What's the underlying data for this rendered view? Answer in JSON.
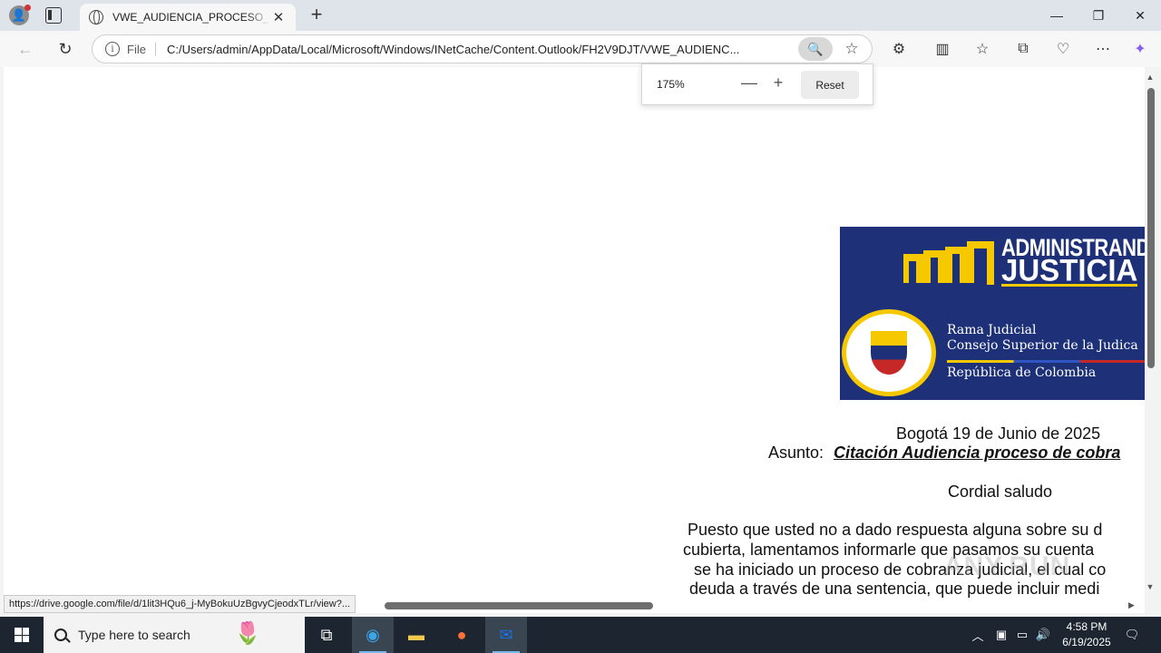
{
  "browser": {
    "tab_title": "VWE_AUDIENCIA_PROCESO_REF",
    "address_prefix": "File",
    "url": "C:/Users/admin/AppData/Local/Microsoft/Windows/INetCache/Content.Outlook/FH2V9DJT/VWE_AUDIENC..."
  },
  "zoom_popup": {
    "level": "175%",
    "minus": "—",
    "plus": "+",
    "reset_label": "Reset"
  },
  "document": {
    "banner": {
      "line1": "ADMINISTRANDO",
      "line2": "JUSTICIA",
      "rama": "Rama Judicial",
      "consejo": "Consejo Superior de la Judica",
      "republica": "República de Colombia"
    },
    "date_line": "Bogotá 19 de Junio de 2025",
    "subject_label": "Asunto:",
    "subject_value": "Citación Audiencia proceso de cobra",
    "greeting": "Cordial saludo",
    "paragraph": [
      "Puesto que usted no a dado respuesta alguna sobre su d",
      "cubierta, lamentamos informarle que pasamos su cuenta",
      "se ha iniciado un proceso de cobranza judicial, el cual co",
      "deuda a través de una sentencia, que puede incluir medi"
    ]
  },
  "status_url": "https://drive.google.com/file/d/1lit3HQu6_j-MyBokuUzBgvyCjeodxTLr/view?...",
  "taskbar": {
    "search_placeholder": "Type here to search",
    "time": "4:58 PM",
    "date": "6/19/2025"
  }
}
